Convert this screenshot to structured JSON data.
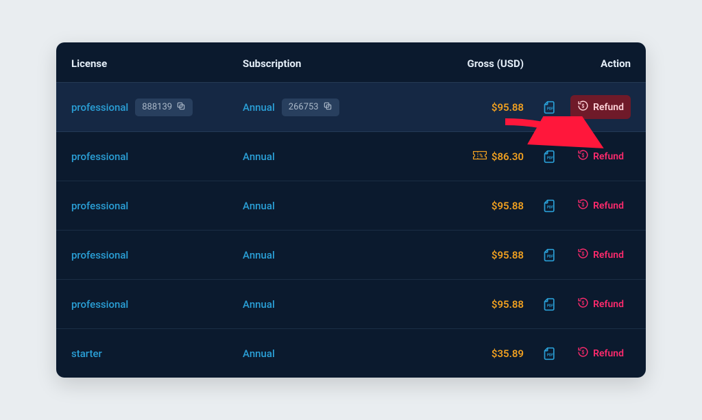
{
  "columns": {
    "license": "License",
    "subscription": "Subscription",
    "gross": "Gross (USD)",
    "action": "Action"
  },
  "rows": [
    {
      "license": "professional",
      "license_id": "888139",
      "subscription": "Annual",
      "subscription_id": "266753",
      "gross": "$95.88",
      "discounted": false,
      "refund": "Refund",
      "highlighted": true,
      "refund_focused": true
    },
    {
      "license": "professional",
      "subscription": "Annual",
      "gross": "$86.30",
      "discounted": true,
      "refund": "Refund"
    },
    {
      "license": "professional",
      "subscription": "Annual",
      "gross": "$95.88",
      "discounted": false,
      "refund": "Refund"
    },
    {
      "license": "professional",
      "subscription": "Annual",
      "gross": "$95.88",
      "discounted": false,
      "refund": "Refund"
    },
    {
      "license": "professional",
      "subscription": "Annual",
      "gross": "$95.88",
      "discounted": false,
      "refund": "Refund"
    },
    {
      "license": "starter",
      "subscription": "Annual",
      "gross": "$35.89",
      "discounted": false,
      "refund": "Refund"
    }
  ]
}
